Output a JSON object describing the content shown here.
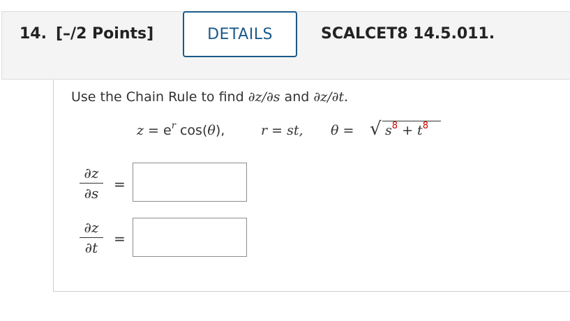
{
  "question": {
    "number": "14.",
    "points": "[–/2 Points]",
    "details_label": "DETAILS",
    "problem_code": "SCALCET8 14.5.011."
  },
  "problem": {
    "instruction_prefix": "Use the Chain Rule to find ",
    "instruction_math1": "∂z/∂s",
    "instruction_and": " and ",
    "instruction_math2": "∂z/∂t",
    "instruction_suffix": ".",
    "equation": {
      "z_lhs": "z",
      "z_eq": " = e",
      "z_exp": "r",
      "z_cos": " cos(",
      "z_theta": "θ",
      "z_close": "),",
      "r_lhs": "r",
      "r_eq": " = ",
      "r_rhs": "st,",
      "theta_lhs": "θ",
      "theta_eq": " = ",
      "sqrt_sign": "√",
      "s_base": "s",
      "s_exp": "8",
      "plus": " + ",
      "t_base": "t",
      "t_exp": "8"
    }
  },
  "answers": [
    {
      "numerator": "∂z",
      "denominator": "∂s",
      "equals": "=",
      "value": "",
      "placeholder": ""
    },
    {
      "numerator": "∂z",
      "denominator": "∂t",
      "equals": "=",
      "value": "",
      "placeholder": ""
    }
  ],
  "colors": {
    "details_border": "#1a5a8a",
    "highlight_red": "#cc0000",
    "header_bg": "#f4f4f4"
  }
}
